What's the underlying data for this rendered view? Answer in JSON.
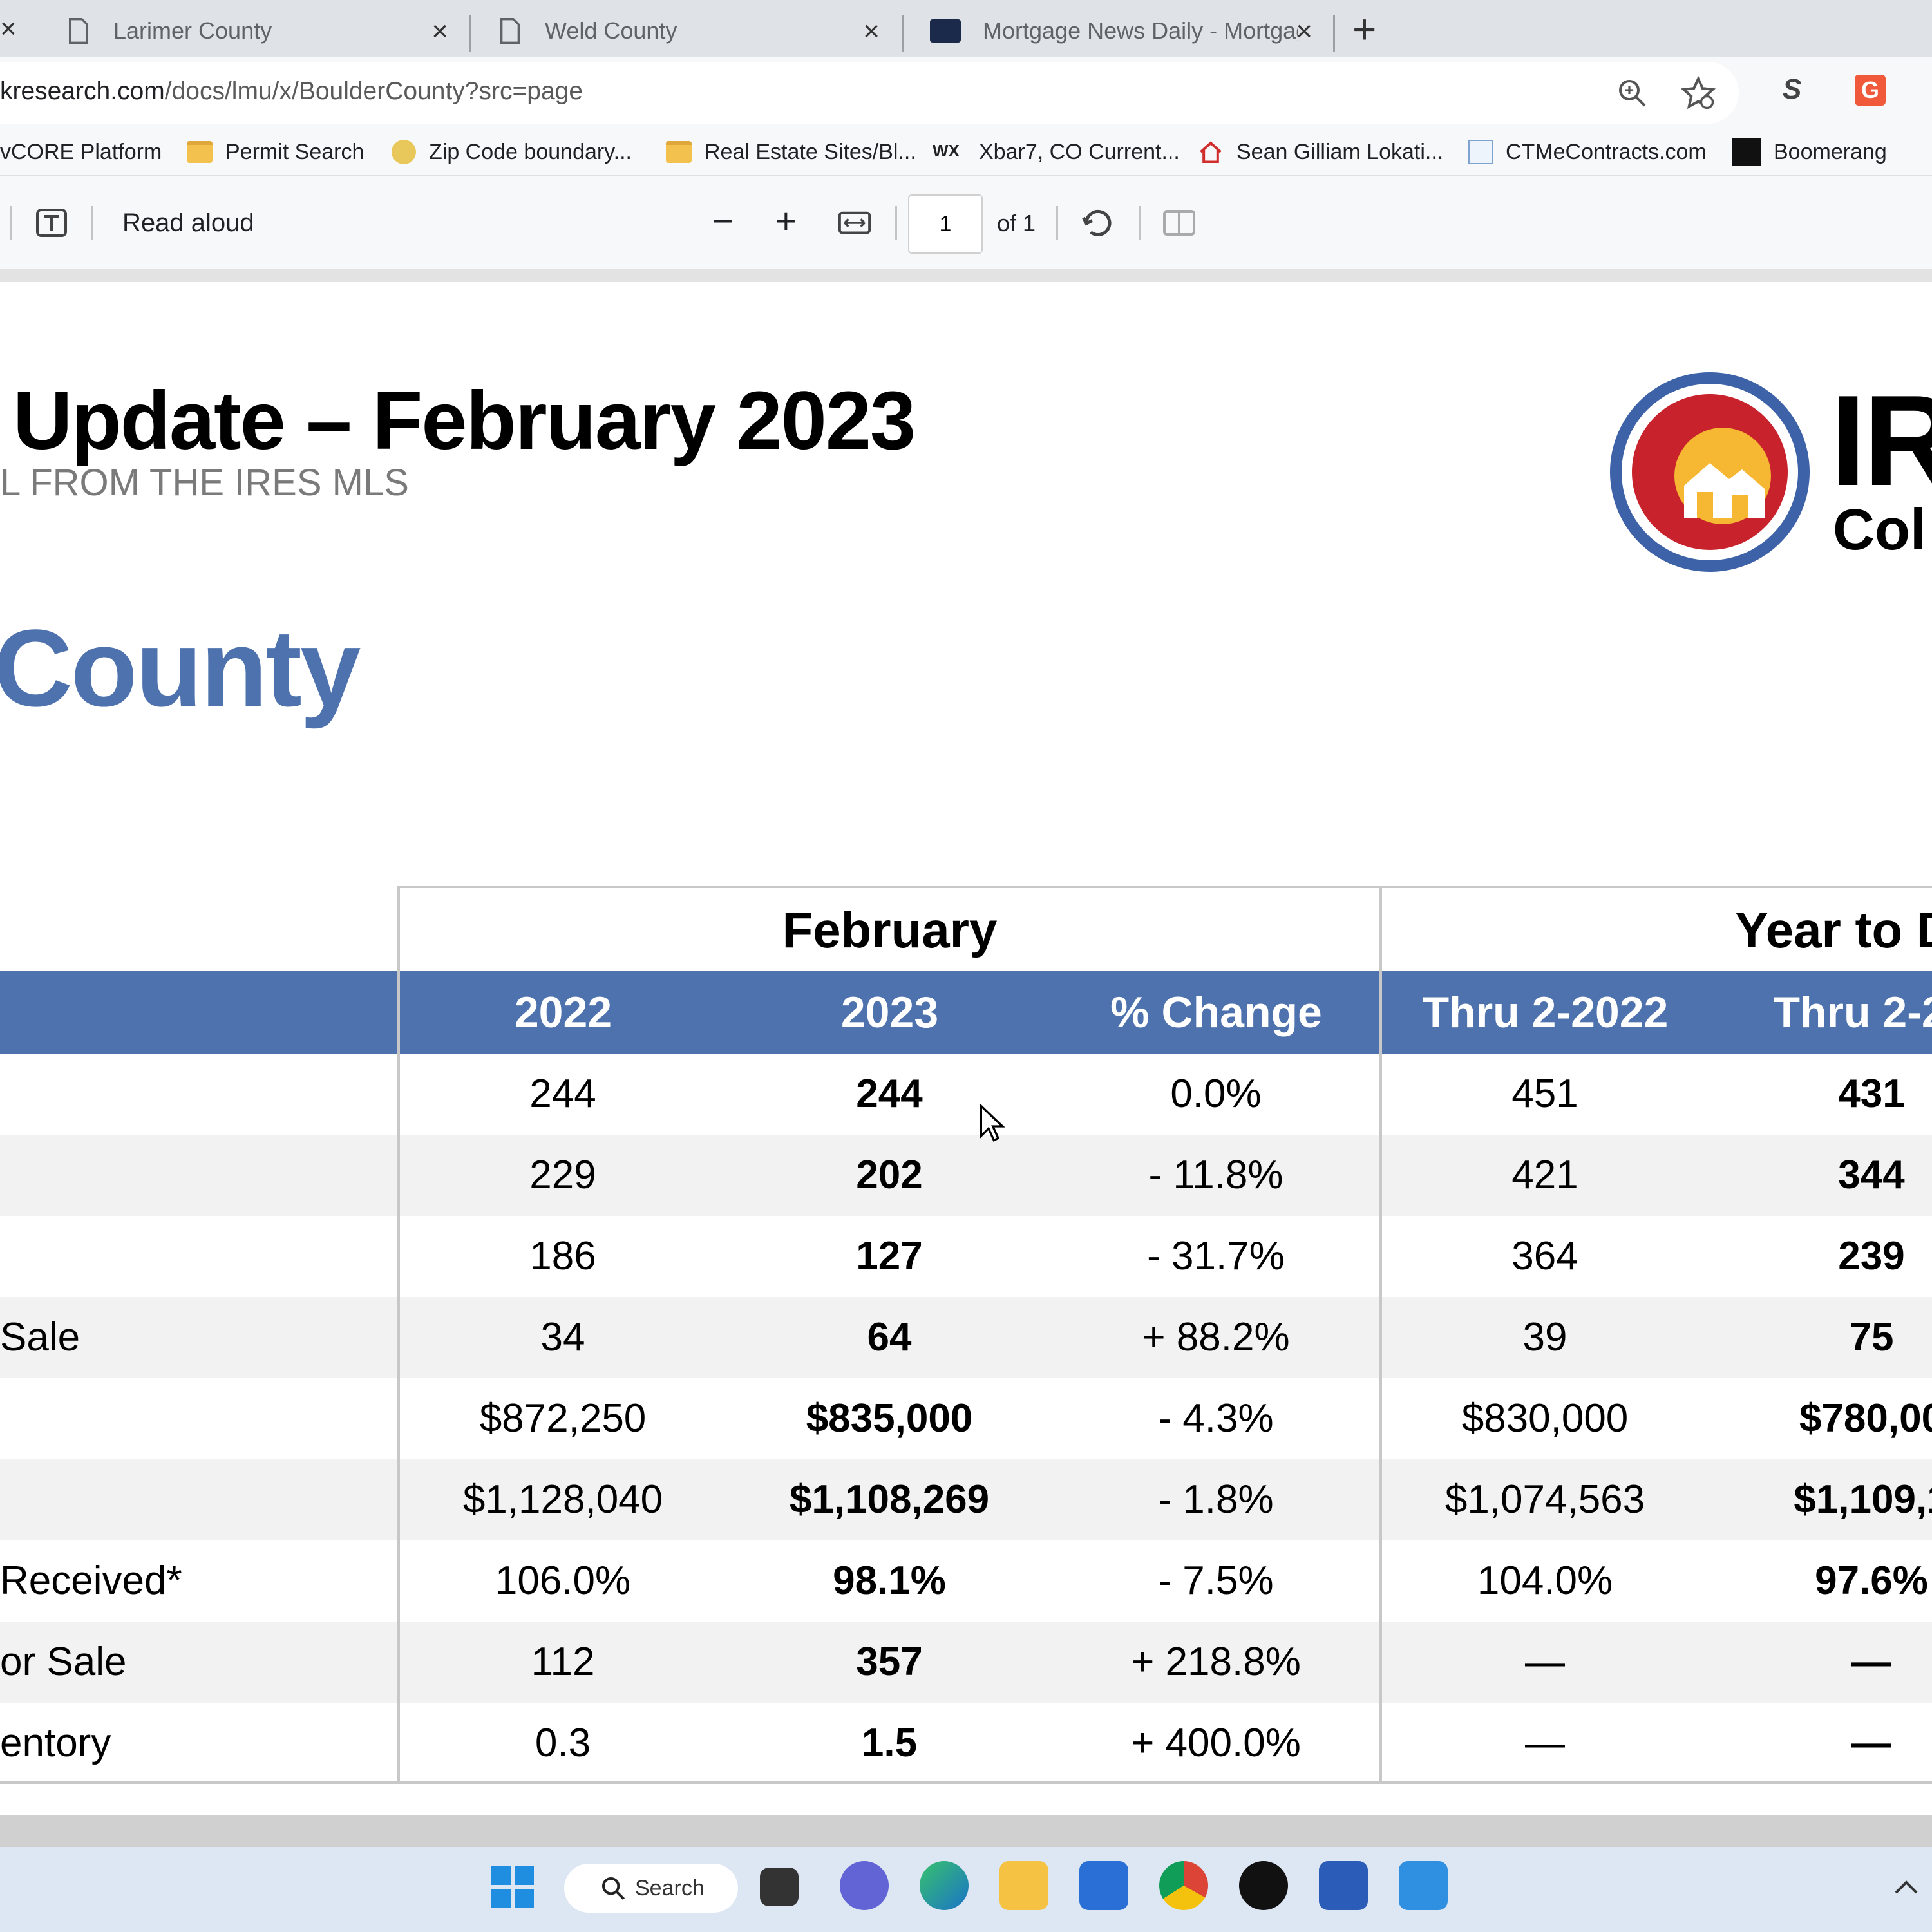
{
  "browser": {
    "tabs": [
      {
        "title": "Larimer County",
        "active": false
      },
      {
        "title": "Weld County",
        "active": false
      },
      {
        "title": "Mortgage News Daily - Mortgag",
        "active": true
      }
    ],
    "new_tab_glyph": "+",
    "close_glyph": "×",
    "url_host": "kresearch.com",
    "url_path": "/docs/lmu/x/BoulderCounty?src=page",
    "bookmarks": [
      {
        "label": "vCORE Platform",
        "icon": "vcore-icon"
      },
      {
        "label": "Permit Search",
        "icon": "folder-icon"
      },
      {
        "label": "Zip Code boundary...",
        "icon": "zip-map-icon"
      },
      {
        "label": "Real Estate Sites/Bl...",
        "icon": "folder-icon"
      },
      {
        "label": "Xbar7, CO Current...",
        "icon": "weather-icon"
      },
      {
        "label": "Sean Gilliam Lokati...",
        "icon": "house-icon"
      },
      {
        "label": "CTMeContracts.com",
        "icon": "ctme-icon"
      },
      {
        "label": "Boomerang",
        "icon": "boomerang-icon"
      }
    ]
  },
  "pdf_toolbar": {
    "read_aloud": "Read aloud",
    "zoom_out": "−",
    "zoom_in": "+",
    "page_value": "1",
    "page_of": "of 1"
  },
  "document": {
    "title": "Update – February 2023",
    "subtitle": "L FROM THE IRES MLS",
    "county_heading": "County",
    "logo_text_1": "IR",
    "logo_text_2": "Col",
    "table": {
      "group_headers": [
        "February",
        "Year to D"
      ],
      "columns": [
        "2022",
        "2023",
        "% Change",
        "Thru 2-2022",
        "Thru 2-20"
      ],
      "rows": [
        {
          "label": "",
          "v": [
            "244",
            "244",
            "0.0%",
            "451",
            "431"
          ]
        },
        {
          "label": "",
          "v": [
            "229",
            "202",
            "- 11.8%",
            "421",
            "344"
          ]
        },
        {
          "label": "",
          "v": [
            "186",
            "127",
            "- 31.7%",
            "364",
            "239"
          ]
        },
        {
          "label": "Sale",
          "v": [
            "34",
            "64",
            "+ 88.2%",
            "39",
            "75"
          ]
        },
        {
          "label": "",
          "v": [
            "$872,250",
            "$835,000",
            "- 4.3%",
            "$830,000",
            "$780,00"
          ]
        },
        {
          "label": "",
          "v": [
            "$1,128,040",
            "$1,108,269",
            "- 1.8%",
            "$1,074,563",
            "$1,109,1"
          ]
        },
        {
          "label": "Received*",
          "v": [
            "106.0%",
            "98.1%",
            "- 7.5%",
            "104.0%",
            "97.6%"
          ]
        },
        {
          "label": "or Sale",
          "v": [
            "112",
            "357",
            "+ 218.8%",
            "—",
            "—"
          ]
        },
        {
          "label": "entory",
          "v": [
            "0.3",
            "1.5",
            "+ 400.0%",
            "—",
            "—"
          ]
        }
      ]
    }
  },
  "taskbar": {
    "search_label": "Search",
    "apps": [
      "windows-start-icon",
      "task-view-icon",
      "teams-chat-icon",
      "edge-icon",
      "file-explorer-icon",
      "store-icon",
      "chrome-icon",
      "app-g-icon",
      "word-icon",
      "photos-icon"
    ]
  }
}
